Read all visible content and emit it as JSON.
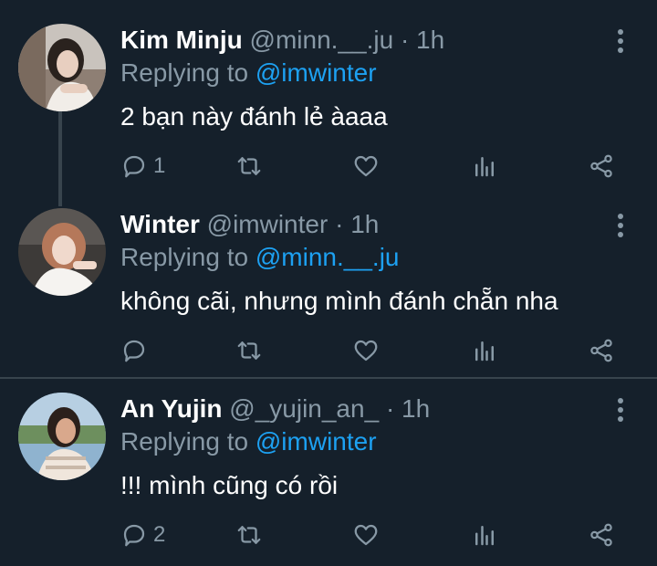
{
  "colors": {
    "background": "#15202b",
    "muted": "#8899a6",
    "link": "#1da1f2",
    "divider": "#38444d"
  },
  "tweets": [
    {
      "name": "Kim Minju",
      "handle": "@minn.__.ju",
      "time": "1h",
      "replying_prefix": "Replying to",
      "replying_handle": "@imwinter",
      "text": "2 bạn này đánh lẻ àaaa",
      "reply_count": "1",
      "retweet_count": "",
      "like_count": ""
    },
    {
      "name": "Winter",
      "handle": "@imwinter",
      "time": "1h",
      "replying_prefix": "Replying to",
      "replying_handle": "@minn.__.ju",
      "text": "không cãi, nhưng mình đánh chẵn nha",
      "reply_count": "",
      "retweet_count": "",
      "like_count": ""
    },
    {
      "name": "An Yujin",
      "handle": "@_yujin_an_",
      "time": "1h",
      "replying_prefix": "Replying to",
      "replying_handle": "@imwinter",
      "text": "!!! mình cũng có rồi",
      "reply_count": "2",
      "retweet_count": "",
      "like_count": ""
    }
  ],
  "separator": "·"
}
